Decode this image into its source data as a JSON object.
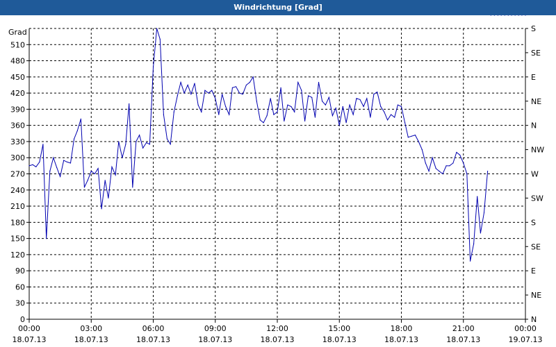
{
  "window": {
    "title": "Windrichtung [Grad]"
  },
  "chart_data": {
    "type": "line",
    "title": "Windrichtung [Grad]",
    "ylabel": "Grad",
    "ylim": [
      0,
      540
    ],
    "y_ticks": [
      0,
      30,
      60,
      90,
      120,
      150,
      180,
      210,
      240,
      270,
      300,
      330,
      360,
      390,
      420,
      450,
      480,
      510
    ],
    "right_axis_labels": [
      "N",
      "NE",
      "E",
      "SE",
      "S",
      "SW",
      "W",
      "NW",
      "N",
      "NE",
      "E",
      "SE",
      "S"
    ],
    "x_ticks": [
      {
        "time": "00:00",
        "date": "18.07.13"
      },
      {
        "time": "03:00",
        "date": "18.07.13"
      },
      {
        "time": "06:00",
        "date": "18.07.13"
      },
      {
        "time": "09:00",
        "date": "18.07.13"
      },
      {
        "time": "12:00",
        "date": "18.07.13"
      },
      {
        "time": "15:00",
        "date": "18.07.13"
      },
      {
        "time": "18:00",
        "date": "18.07.13"
      },
      {
        "time": "21:00",
        "date": "18.07.13"
      },
      {
        "time": "00:00",
        "date": "19.07.13"
      }
    ],
    "grid": true,
    "line_color": "#0000b0",
    "series": [
      {
        "x_hours": [
          0,
          0.17,
          0.33,
          0.5,
          0.67,
          0.83,
          1.0,
          1.17,
          1.33,
          1.5,
          1.67,
          1.83,
          2.0,
          2.17,
          2.33,
          2.5,
          2.67,
          2.83,
          3.0,
          3.17,
          3.33,
          3.5,
          3.67,
          3.83,
          4.0,
          4.17,
          4.33,
          4.5,
          4.67,
          4.83,
          5.0,
          5.17,
          5.33,
          5.5,
          5.67,
          5.83,
          6.0,
          6.17,
          6.33,
          6.5,
          6.67,
          6.83,
          7.0,
          7.17,
          7.33,
          7.5,
          7.67,
          7.83,
          8.0,
          8.17,
          8.33,
          8.5,
          8.67,
          8.83,
          9.0,
          9.17,
          9.33,
          9.5,
          9.67,
          9.83,
          10.0,
          10.17,
          10.33,
          10.5,
          10.67,
          10.83,
          11.0,
          11.17,
          11.33,
          11.5,
          11.67,
          11.83,
          12.0,
          12.17,
          12.33,
          12.5,
          12.67,
          12.83,
          13.0,
          13.17,
          13.33,
          13.5,
          13.67,
          13.83,
          14.0,
          14.17,
          14.33,
          14.5,
          14.67,
          14.83,
          15.0,
          15.17,
          15.33,
          15.5,
          15.67,
          15.83,
          16.0,
          16.17,
          16.33,
          16.5,
          16.67,
          16.83,
          17.0,
          17.17,
          17.33,
          17.5,
          17.67,
          17.83,
          18.0,
          18.17,
          18.33,
          18.5,
          18.67,
          18.83,
          19.0,
          19.17,
          19.33,
          19.5,
          19.67,
          19.83,
          20.0,
          20.17,
          20.33,
          20.5,
          20.67,
          20.83,
          21.0,
          21.17,
          21.33,
          21.5,
          21.67,
          21.83,
          22.0,
          22.17,
          22.33,
          22.5,
          22.67,
          22.83,
          23.0,
          23.17,
          23.33,
          23.5,
          23.67,
          23.83,
          24.0
        ],
        "values": [
          285,
          287,
          283,
          292,
          325,
          150,
          275,
          300,
          282,
          265,
          295,
          292,
          290,
          335,
          350,
          372,
          245,
          258,
          275,
          270,
          280,
          205,
          258,
          225,
          283,
          268,
          330,
          300,
          325,
          400,
          245,
          330,
          342,
          318,
          328,
          325,
          468,
          540,
          520,
          380,
          335,
          325,
          385,
          415,
          440,
          420,
          435,
          418,
          438,
          398,
          385,
          425,
          420,
          425,
          410,
          380,
          418,
          395,
          380,
          430,
          432,
          420,
          418,
          435,
          440,
          450,
          405,
          370,
          365,
          378,
          410,
          380,
          385,
          430,
          368,
          398,
          395,
          385,
          440,
          425,
          368,
          415,
          412,
          375,
          440,
          405,
          398,
          412,
          378,
          392,
          360,
          395,
          365,
          398,
          380,
          410,
          408,
          395,
          410,
          375,
          418,
          422,
          395,
          385,
          370,
          380,
          375,
          398,
          395,
          365,
          338,
          340,
          342,
          330,
          315,
          290,
          275,
          300,
          280,
          275,
          270,
          285,
          285,
          290,
          310,
          305,
          290,
          270,
          108,
          140,
          228,
          160,
          198,
          275
        ]
      }
    ]
  }
}
